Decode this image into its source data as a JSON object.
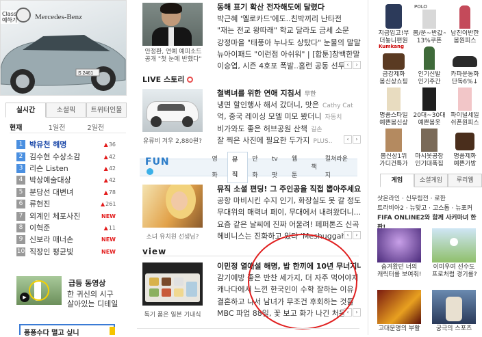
{
  "left": {
    "ad": {
      "brand": "Mercedes-Benz",
      "class_label": "Class\n예하기",
      "plate": "S 2461"
    },
    "tabs": [
      {
        "label": "실시간"
      },
      {
        "label": "소셜픽"
      },
      {
        "label": "트위터인물"
      }
    ],
    "subtabs": [
      {
        "label": "현재"
      },
      {
        "label": "1일전"
      },
      {
        "label": "2일전"
      }
    ],
    "ranks": [
      {
        "num": "1",
        "title": "박유천 해명",
        "change": "36",
        "dir": "up"
      },
      {
        "num": "2",
        "title": "김수현 수상소감",
        "change": "42",
        "dir": "up"
      },
      {
        "num": "3",
        "title": "리슨 Listen",
        "change": "42",
        "dir": "up"
      },
      {
        "num": "4",
        "title": "박상예술대상",
        "change": "42",
        "dir": "up"
      },
      {
        "num": "5",
        "title": "분당선 대변녀",
        "change": "78",
        "dir": "up"
      },
      {
        "num": "6",
        "title": "류현진",
        "change": "261",
        "dir": "up"
      },
      {
        "num": "7",
        "title": "외계인 체포사진",
        "change": "NEW",
        "dir": "new"
      },
      {
        "num": "8",
        "title": "이혁준",
        "change": "11",
        "dir": "up"
      },
      {
        "num": "9",
        "title": "신보라 매너손",
        "change": "NEW",
        "dir": "new"
      },
      {
        "num": "10",
        "title": "직장인 평균빛",
        "change": "NEW",
        "dir": "new"
      }
    ],
    "clip": {
      "title": "급등 동영상",
      "line1": "한 귀신의 시구",
      "line2": "살아있는 디테일"
    },
    "search_text": "퐁퐁수다 떨고 싶니"
  },
  "mid": {
    "photo1_caption": "안정환, 연예 예피소드\n공개 \"첫 눈에 반했다\"",
    "news1": [
      {
        "text": "동해 표기 확산 전자해도에 달렸다",
        "bold": true
      },
      {
        "text": "박근혜 '옐로카드'에도..친박끼리 난타전",
        "bold": false
      },
      {
        "text": "\"재는 전교 왕따래\" 학교 달라도 금세 소문",
        "bold": false
      },
      {
        "text": "강정마을 \"태풍아 누나도 상탔다\" 눈물의 말말말",
        "bold": false
      },
      {
        "text": "뉴아이패드 \"이런점 아쉬워\" | [합툰]창백한말",
        "bold": false
      },
      {
        "text": "이승엽, 시즌 4호포 폭발..홈런 공동 선두",
        "bold": false
      }
    ],
    "story_label": "LIVE 스토리",
    "photo2_caption": "유류비 겨우 2,880원?",
    "news2": [
      {
        "text": "철벽녀를 위한 연애 지침서",
        "src": "무한",
        "bold": true
      },
      {
        "text": "냉면 할인행사 해서 갔더니, 맛은",
        "src": "Cathy Cat",
        "bold": false
      },
      {
        "text": "억, 중국 레이싱 모델 미모 봤더니",
        "src": "자동치",
        "bold": false
      },
      {
        "text": "비가와도 좋은 허브공원 산책",
        "src": "길손",
        "bold": false
      },
      {
        "text": "잘 찍은 사진에 필요한 두가지",
        "src": "PLUS..",
        "bold": false
      }
    ],
    "fun": {
      "logo": "FUN",
      "tabs": [
        {
          "label": "영화"
        },
        {
          "label": "뮤직"
        },
        {
          "label": "만화"
        },
        {
          "label": "tv팟"
        },
        {
          "label": "웹툰"
        },
        {
          "label": "책"
        },
        {
          "label": "컬쳐라운지"
        }
      ]
    },
    "photo3_caption": "소녀 유치원 선생님?",
    "news3": [
      {
        "text": "뮤직 소셜 편딩! 그 주인공을 직접 뽑아주세요",
        "bold": true
      },
      {
        "text": "공항 마비시킨 수지 인기, 화장실도 못 갈 정도",
        "bold": false
      },
      {
        "text": "무대위의 매력녀 페이, 무대에서 내려왔더니...",
        "bold": false
      },
      {
        "text": "요즘 같은 날씨에 진짜 어울려! 페퍼톤즈 신곡",
        "bold": false
      },
      {
        "text": "헤비니스는 진화하고 있다 'Meshuggah'",
        "bold": false
      }
    ],
    "view_label": "view",
    "photo4_caption": "독기 품은 일본 기내식",
    "news4": [
      {
        "text": "이민정 열애설 해명, 밥 한끼에 10년 무너지나",
        "bold": true
      },
      {
        "text": "감기예방 좋은 반찬 세가지, 더 자주 먹어야지",
        "bold": false
      },
      {
        "text": "캐나다에서 느낀 한국인이 수학 잘하는 이유",
        "bold": false
      },
      {
        "text": "결혼하고 나서 남녀가 무조건 후회하는 것들",
        "bold": false
      },
      {
        "text": "MBC 파업 88일, 꽃 보고 화가 나긴 처음",
        "bold": false
      }
    ]
  },
  "right": {
    "products": [
      {
        "label": "지금입고!부\n더놓니편원"
      },
      {
        "label": "봄/운~반값~\n13%쿠폰"
      },
      {
        "label": "남친이반한\n봄원피스"
      },
      {
        "label": "금강제화\n봄신상쇼핑"
      },
      {
        "label": "인기신발\n인기주간"
      },
      {
        "label": "카파운동화\n단독6%↓"
      },
      {
        "label": "명품스타일\n예쁜봄신상"
      },
      {
        "label": "20대~30대\n예쁜봄옷"
      },
      {
        "label": "파이널세일\n쉬폰원피스"
      },
      {
        "label": "봄신상1위\n가디건특가"
      },
      {
        "label": "마시옷공장\n인기대폭집"
      },
      {
        "label": "명품제화\n예쁜가방"
      }
    ],
    "brand_tag": "Kumkang",
    "polo_tag": "POLO",
    "game_tabs": [
      {
        "label": "게임"
      },
      {
        "label": "소셜게임"
      },
      {
        "label": "루리웹"
      }
    ],
    "game_links": [
      "삿온라인 · 신무림전 · 로한",
      "트라비아2 · 뉴맞고 · 고스톱 · 뉴포커",
      "FIFA ONLINE2와 함께 사커마녀 한판!"
    ],
    "games": [
      {
        "label": "숨겨왔던 너의\n캐릭터를 보여줘!"
      },
      {
        "label": "이미우여 선수도\n프로처럼 경기를?"
      },
      {
        "label": "고대문명의 부활"
      },
      {
        "label": "궁극의 스포츠"
      }
    ],
    "colors": {
      "accent_blue": "#1a47a8",
      "red": "#e31b1b",
      "fun_blue": "#2a7bc8"
    }
  }
}
